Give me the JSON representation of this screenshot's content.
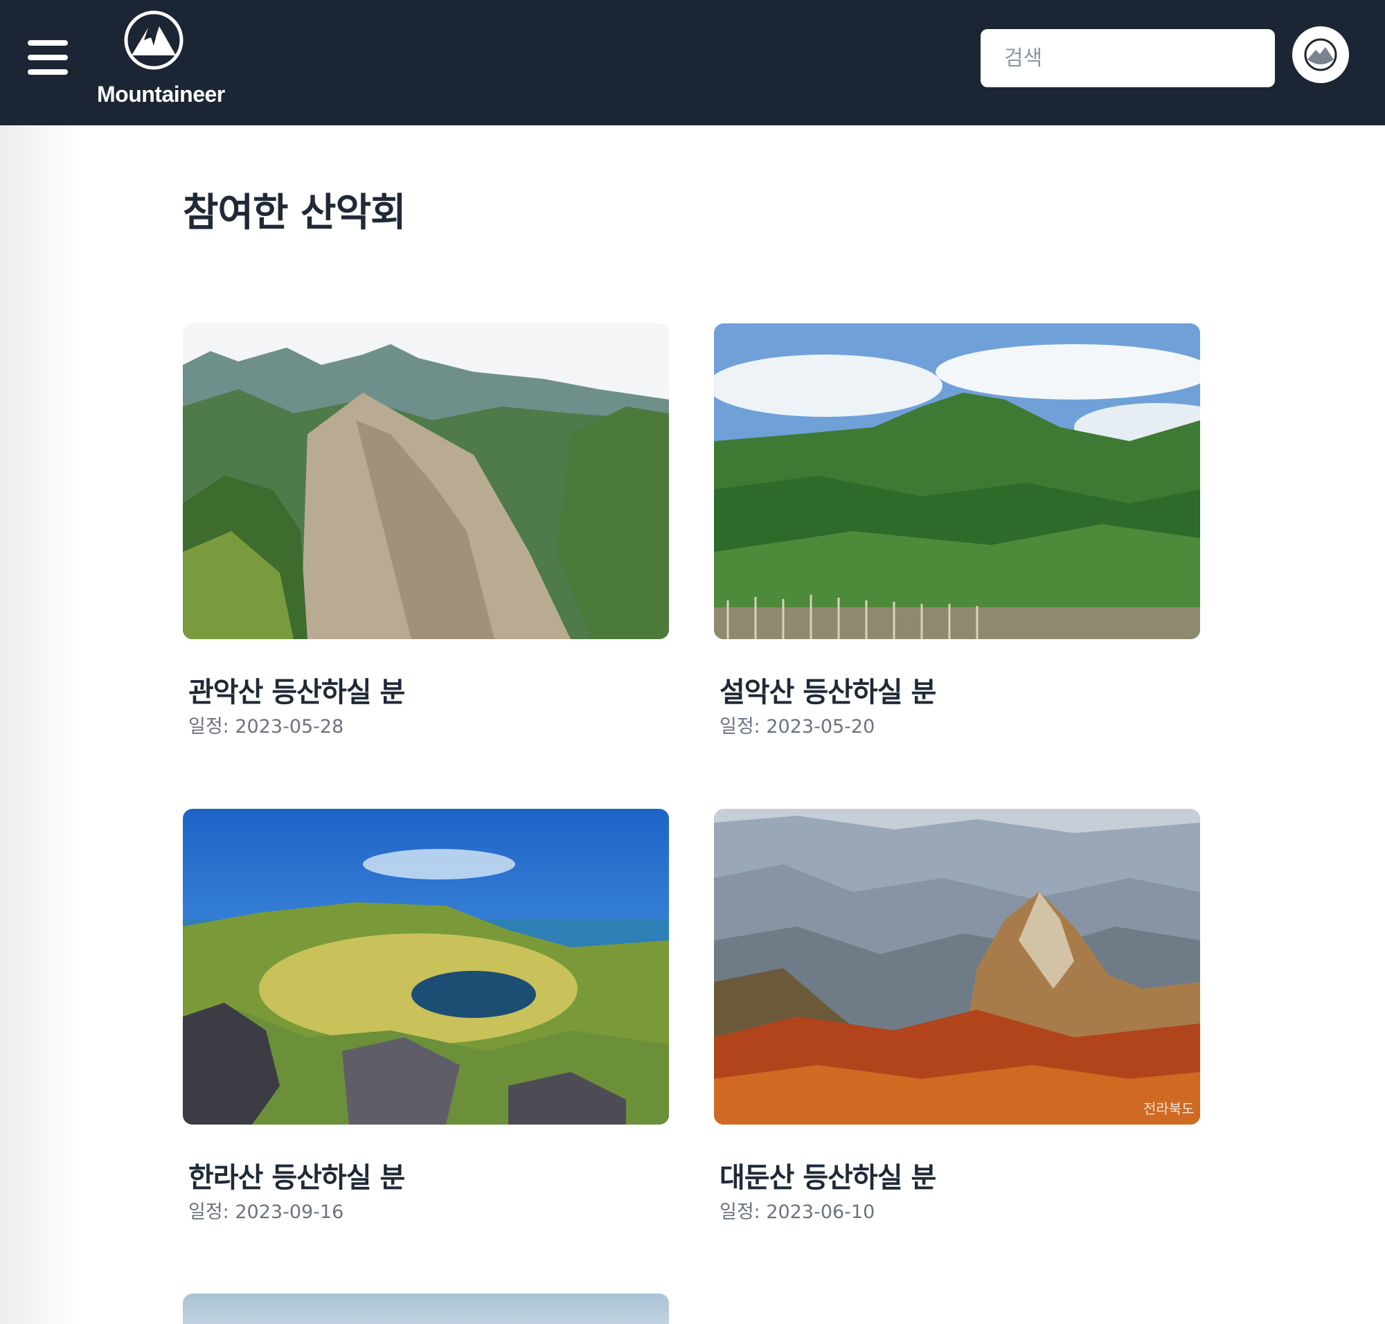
{
  "header": {
    "brand_name": "Mountaineer",
    "search_placeholder": "검색",
    "menu_icon": "hamburger-icon",
    "logo_icon": "mountain-icon",
    "avatar_icon": "user-avatar-icon",
    "colors": {
      "navbar": "#1c2533",
      "text_primary": "#1f2937",
      "text_secondary": "#6b7280"
    }
  },
  "main": {
    "title": "참여한 산악회",
    "meetups": [
      {
        "title": "관악산 등산하실 분",
        "date_label": "일정:",
        "date": "2023-05-28",
        "image": "rocky granite peak with green forest"
      },
      {
        "title": "설악산 등산하실 분",
        "date_label": "일정:",
        "date": "2023-05-20",
        "image": "green forested mountain under cloudy blue sky"
      },
      {
        "title": "한라산 등산하실 분",
        "date_label": "일정:",
        "date": "2023-09-16",
        "image": "crater lake under bright blue sky"
      },
      {
        "title": "대둔산 등산하실 분",
        "date_label": "일정:",
        "date": "2023-06-10",
        "image": "autumn rocky peaks with misty valley"
      }
    ],
    "image_watermark": "전라북도"
  }
}
